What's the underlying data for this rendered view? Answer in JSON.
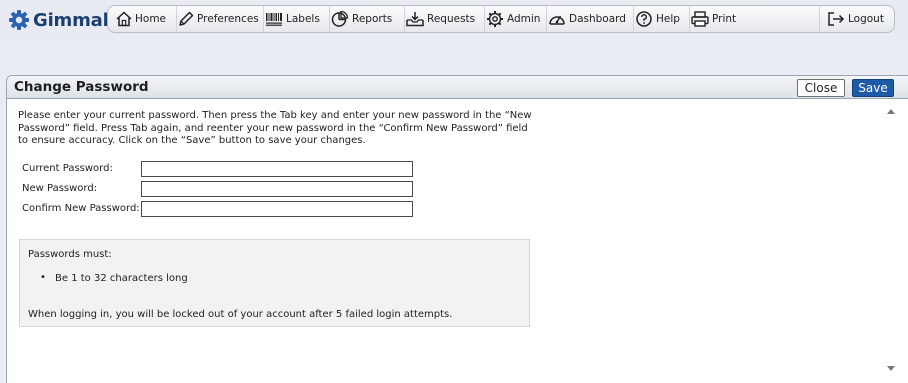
{
  "app": {
    "logo_text": "Gimmal",
    "accent": "#1b3f73"
  },
  "nav": {
    "home": "Home",
    "preferences": "Preferences",
    "labels": "Labels",
    "reports": "Reports",
    "requests": "Requests",
    "admin": "Admin",
    "dashboard": "Dashboard",
    "help": "Help",
    "print": "Print",
    "logout": "Logout"
  },
  "dialog": {
    "title": "Change Password",
    "close_label": "Close",
    "save_label": "Save",
    "instructions": "Please enter your current password. Then press the Tab key and enter your new password in the “New Password” field. Press Tab again, and reenter your new password in the “Confirm New Password” field to ensure accuracy. Click on the “Save” button to save your changes.",
    "fields": {
      "current_label": "Current Password:",
      "current_value": "",
      "new_label": "New Password:",
      "new_value": "",
      "confirm_label": "Confirm New Password:",
      "confirm_value": ""
    },
    "rules": {
      "heading": "Passwords must:",
      "items": [
        "Be 1 to 32 characters long"
      ],
      "footer": "When logging in, you will be locked out of your account after 5 failed login attempts."
    },
    "save_color": "#1d5aa8"
  }
}
